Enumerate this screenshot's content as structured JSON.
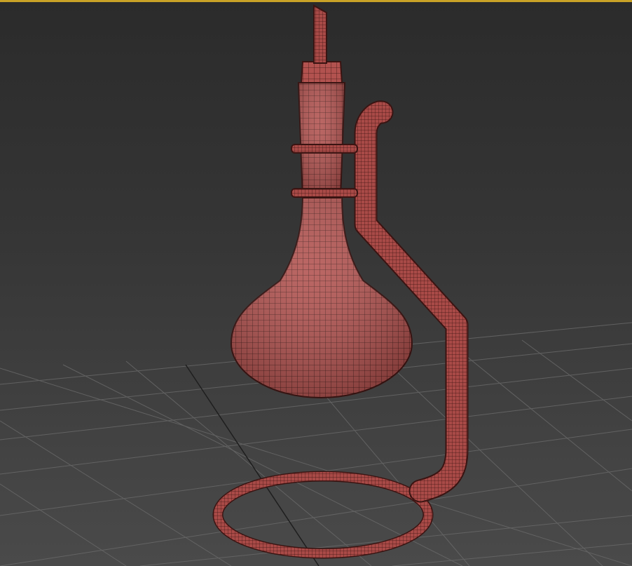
{
  "viewport": {
    "border_color": "#c9a227",
    "background_color": "#3a3a3a",
    "grid_color": "#6a6a6a"
  },
  "model": {
    "mesh_color": "#b2524f",
    "wire_color": "#3a1412"
  }
}
